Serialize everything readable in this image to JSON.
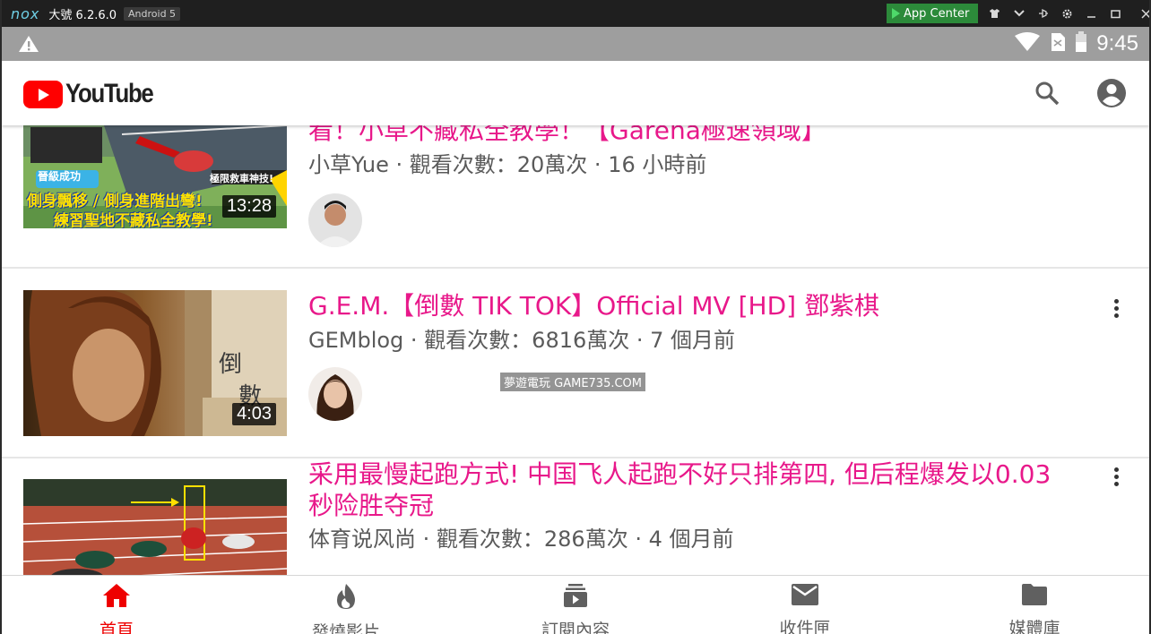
{
  "emulator": {
    "logo": "nox",
    "title": "大號 6.2.6.0",
    "android_badge": "Android 5",
    "app_center_label": "App Center"
  },
  "status_bar": {
    "time": "9:45",
    "icons": [
      "warning-icon",
      "wifi-icon",
      "no-sim-icon",
      "battery-icon"
    ]
  },
  "header": {
    "logo_text": "YouTube",
    "brand_color": "#ff0000",
    "icons": [
      "search-icon",
      "account-icon"
    ]
  },
  "videos": [
    {
      "title": "看！小草不藏私全教學！【Garena極速領域】",
      "channel": "小草Yue",
      "meta": "小草Yue · 觀看次數：20萬次 · 16 小時前",
      "duration": "13:28",
      "thumb_text": [
        "晉級成功",
        "極限救車神技!",
        "側身飄移 / 側身進階出彎!",
        "練習聖地不藏私全教學!"
      ]
    },
    {
      "title": "G.E.M.【倒數 TIK TOK】Official MV [HD] 鄧紫棋",
      "channel": "GEMblog",
      "meta": "GEMblog · 觀看次數：6816萬次 · 7 個月前",
      "duration": "4:03",
      "thumb_text": [
        "倒",
        "數"
      ]
    },
    {
      "title": "采用最慢起跑方式! 中国飞人起跑不好只排第四, 但后程爆发以0.03秒险胜夺冠",
      "channel": "体育说风尚",
      "meta": "体育说风尚 · 觀看次數：286萬次 · 4 個月前",
      "duration": ""
    }
  ],
  "watermark": "夢遊電玩 GAME735.COM",
  "bottom_nav": [
    {
      "label": "首頁",
      "icon": "home-icon",
      "active": true
    },
    {
      "label": "發燒影片",
      "icon": "fire-icon",
      "active": false
    },
    {
      "label": "訂閱內容",
      "icon": "subscriptions-icon",
      "active": false
    },
    {
      "label": "收件匣",
      "icon": "inbox-icon",
      "active": false
    },
    {
      "label": "媒體庫",
      "icon": "library-icon",
      "active": false
    }
  ],
  "colors": {
    "title_pink": "#e8188a",
    "active_nav": "#ee0000",
    "status_bar_gray": "#9e9e9e"
  }
}
